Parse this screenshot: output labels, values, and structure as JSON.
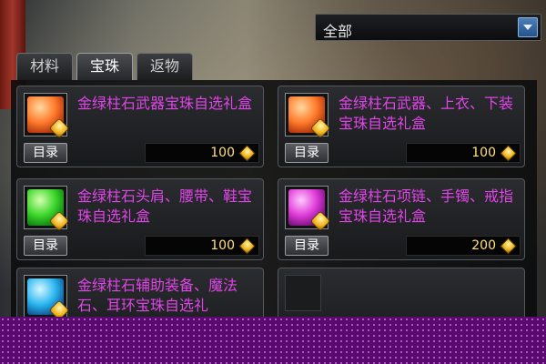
{
  "filter": {
    "selected": "全部"
  },
  "tabs": [
    {
      "label": "材料",
      "active": false
    },
    {
      "label": "宝珠",
      "active": true
    },
    {
      "label": "返物",
      "active": false
    }
  ],
  "items": [
    {
      "name": "金绿柱石武器宝珠自选礼盒",
      "price": "100",
      "button": "目录",
      "icon": "orange-gem-box-icon",
      "color": "#ff7a2a"
    },
    {
      "name": "金绿柱石武器、上衣、下装宝珠自选礼盒",
      "price": "100",
      "button": "目录",
      "icon": "orange-gem-box-icon",
      "color": "#ff7a2a"
    },
    {
      "name": "金绿柱石头肩、腰带、鞋宝珠自选礼盒",
      "price": "100",
      "button": "目录",
      "icon": "green-gem-box-icon",
      "color": "#3ad62a"
    },
    {
      "name": "金绿柱石项链、手镯、戒指宝珠自选礼盒",
      "price": "200",
      "button": "目录",
      "icon": "magenta-gem-box-icon",
      "color": "#e03ad8"
    },
    {
      "name": "金绿柱石辅助装备、魔法石、耳环宝珠自选礼",
      "price": "",
      "button": "",
      "icon": "blue-gem-box-icon",
      "color": "#2ab6f0"
    }
  ],
  "colors": {
    "item_name": "#e045e8",
    "price": "#ffe07a",
    "overlay": "#5a0a6e"
  }
}
